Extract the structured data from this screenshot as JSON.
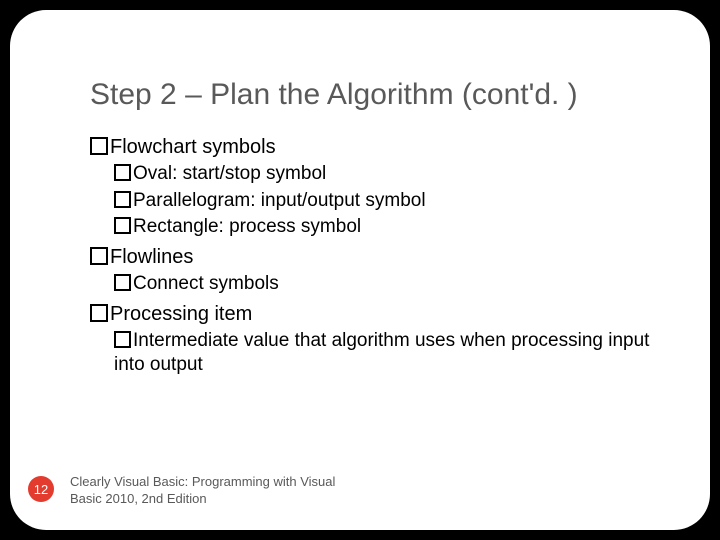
{
  "title": "Step 2 – Plan the Algorithm (cont'd. )",
  "bullets": {
    "b1": "Flowchart symbols",
    "b1a": "Oval: start/stop symbol",
    "b1b": "Parallelogram: input/output symbol",
    "b1c": "Rectangle: process symbol",
    "b2": "Flowlines",
    "b2a": "Connect symbols",
    "b3": "Processing item",
    "b3a": "Intermediate value that algorithm uses when processing input into output"
  },
  "page_number": "12",
  "footer": "Clearly Visual Basic: Programming with Visual Basic 2010, 2nd Edition"
}
